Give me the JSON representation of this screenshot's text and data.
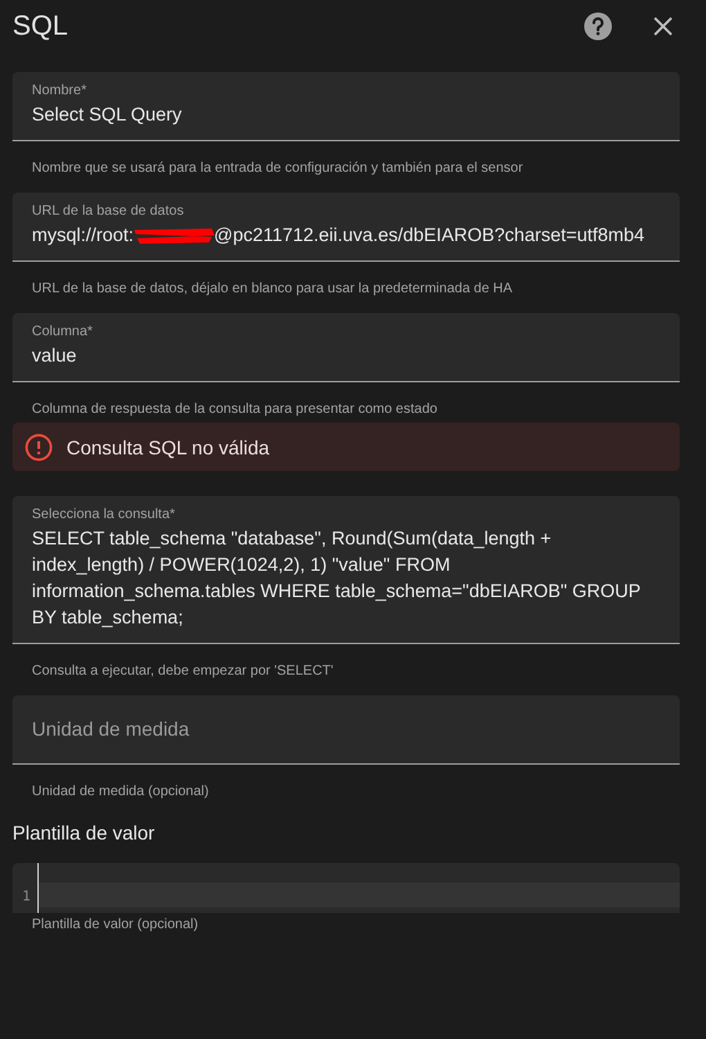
{
  "dialog": {
    "title": "SQL"
  },
  "sections": [
    {
      "kind": "field",
      "label": "Nombre*",
      "value_parts": [
        {
          "kind": "text",
          "text": "Select SQL Query"
        }
      ],
      "helper": "Nombre que se usará para la entrada de configuración y también para el sensor"
    },
    {
      "kind": "field",
      "label": "URL de la base de datos",
      "value_parts": [
        {
          "kind": "text",
          "text": "mysql://root:"
        },
        {
          "kind": "redaction"
        },
        {
          "kind": "text",
          "text": "@pc211712.eii.uva.es/dbEIAROB?charset=utf8mb4"
        }
      ],
      "helper": "URL de la base de datos, déjalo en blanco para usar la predeterminada de HA"
    },
    {
      "kind": "field",
      "label": "Columna*",
      "value_parts": [
        {
          "kind": "text",
          "text": "value"
        }
      ],
      "helper": "Columna de respuesta de la consulta para presentar como estado"
    },
    {
      "kind": "alert",
      "text": "Consulta SQL no válida"
    },
    {
      "kind": "field",
      "label": "Selecciona la consulta*",
      "value_parts": [
        {
          "kind": "text",
          "text": "SELECT table_schema \"database\", Round(Sum(data_length + index_length) / POWER(1024,2), 1) \"value\" FROM information_schema.tables WHERE table_schema=\"dbEIAROB\" GROUP BY table_schema;"
        }
      ],
      "helper": "Consulta a ejecutar, debe empezar por 'SELECT'"
    },
    {
      "kind": "placeholder_field",
      "placeholder": "Unidad de medida",
      "helper": "Unidad de medida (opcional)"
    },
    {
      "kind": "heading",
      "text": "Plantilla de valor"
    },
    {
      "kind": "code_editor",
      "line_number": "1",
      "helper": "Plantilla de valor (opcional)"
    }
  ]
}
